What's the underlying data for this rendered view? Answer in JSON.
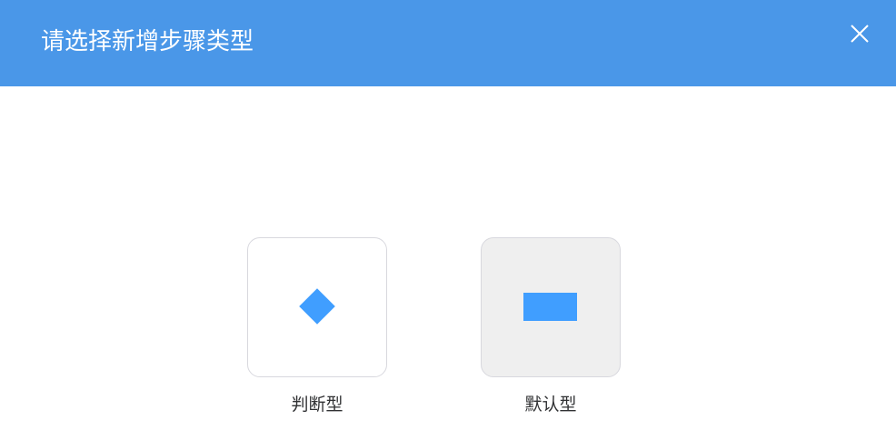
{
  "dialog": {
    "title": "请选择新增步骤类型",
    "close_icon": "close-icon",
    "header_color": "#4a97e8"
  },
  "options": [
    {
      "label": "判断型",
      "icon": "diamond-icon",
      "selected": false
    },
    {
      "label": "默认型",
      "icon": "rectangle-icon",
      "selected": true
    }
  ],
  "colors": {
    "icon": "#409eff",
    "selected_card": "#efefef"
  }
}
